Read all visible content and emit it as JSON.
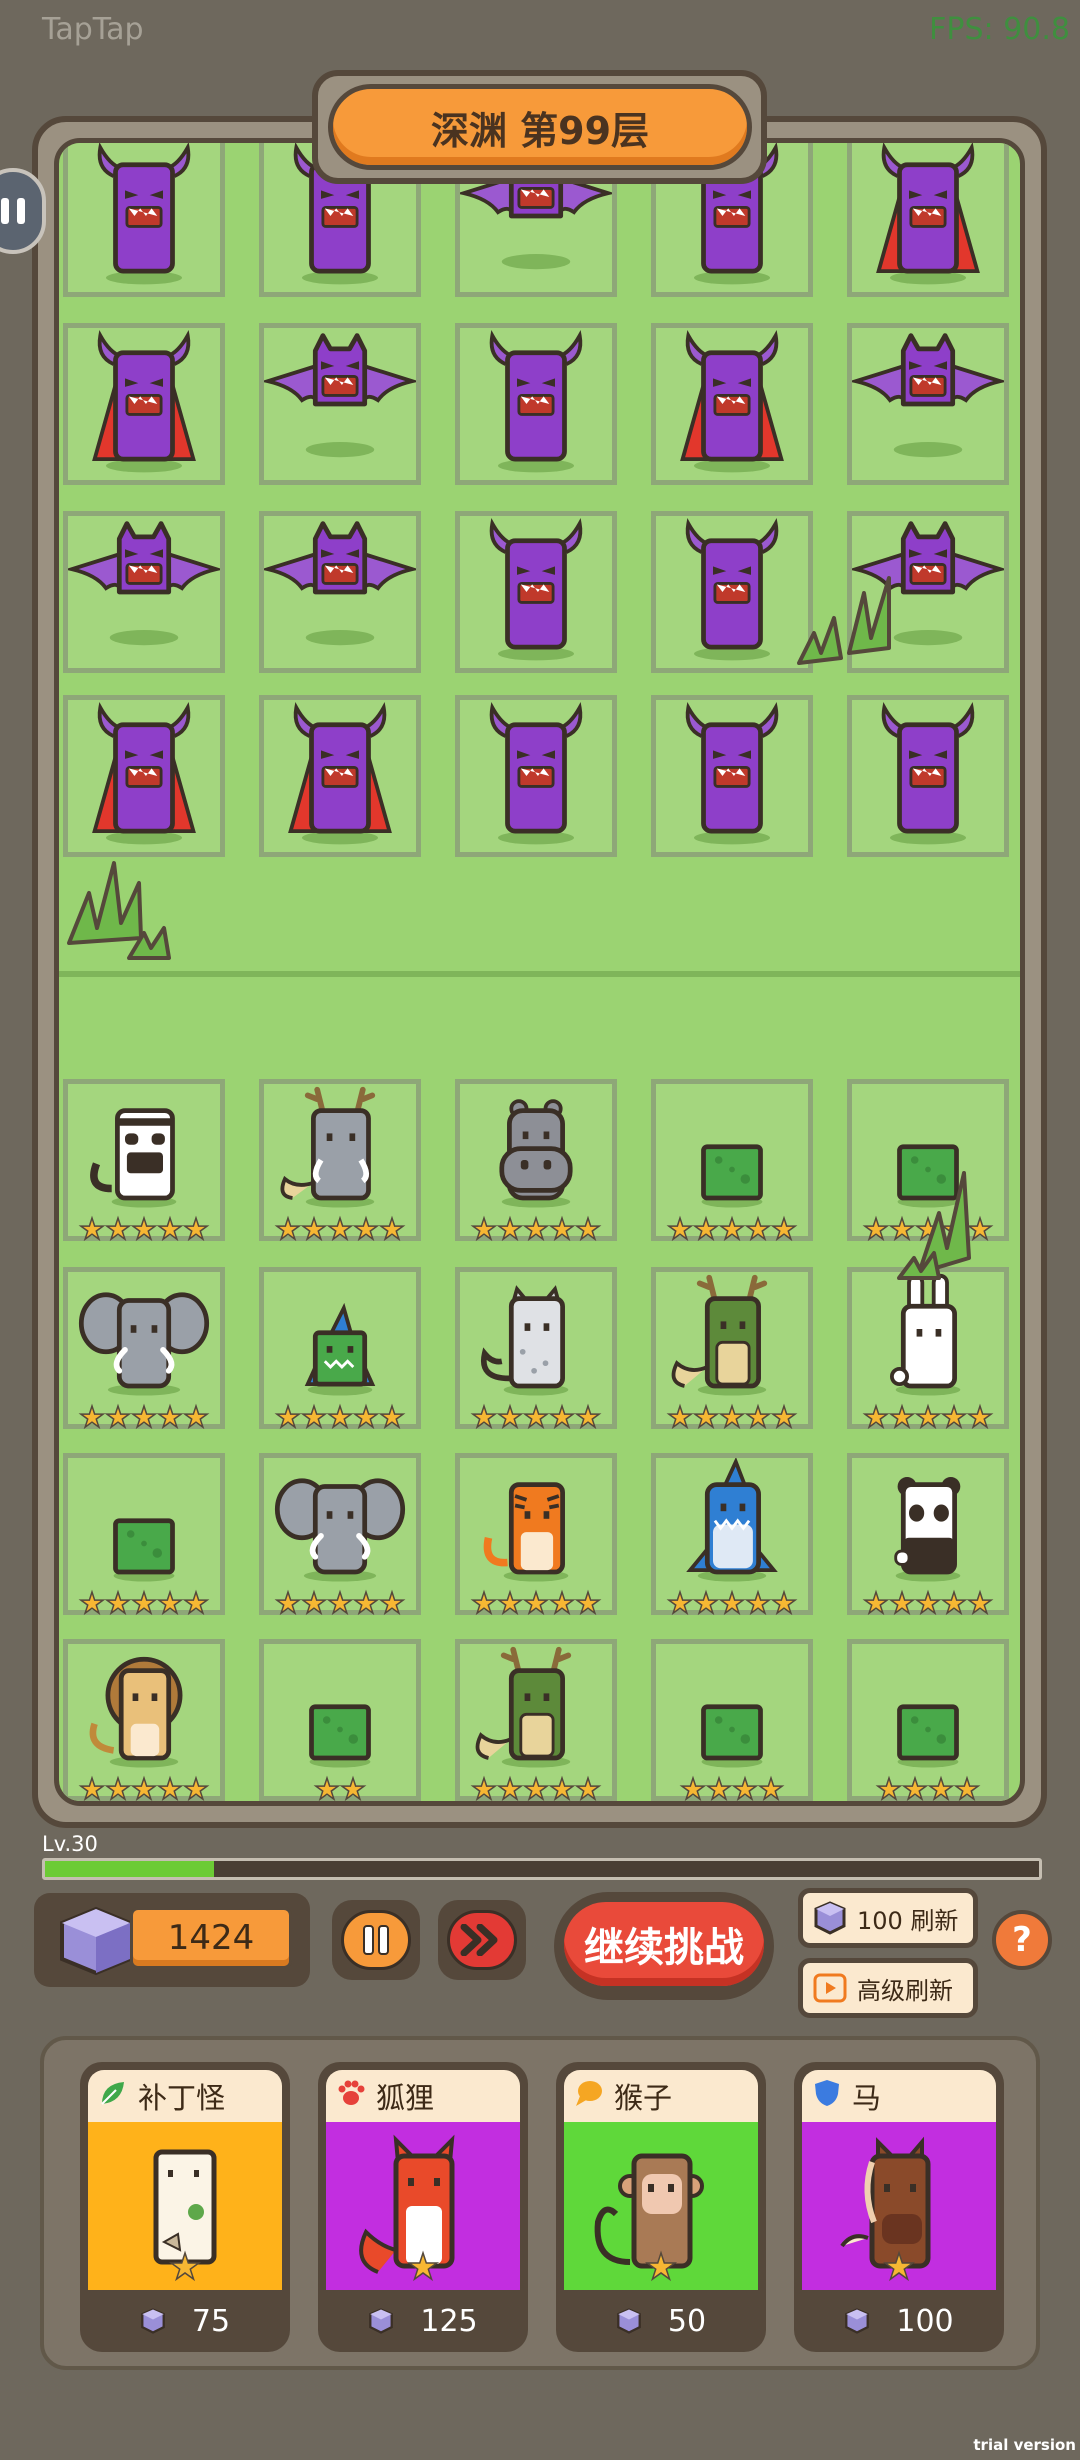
{
  "overlay": {
    "app_name": "TapTap",
    "fps": "FPS: 90.8"
  },
  "stage": {
    "title": "深渊 第99层"
  },
  "enemies": [
    [
      "devil-plain",
      "devil-plain",
      "bat",
      "devil-plain",
      "devil-cape"
    ],
    [
      "devil-cape",
      "bat",
      "devil-plain",
      "devil-cape",
      "bat"
    ],
    [
      "bat",
      "bat",
      "devil-plain",
      "devil-plain",
      "bat"
    ],
    [
      "devil-cape",
      "devil-cape",
      "devil-plain",
      "devil-plain",
      "devil-plain"
    ]
  ],
  "team": [
    [
      {
        "unit": "panda-tiger",
        "stars": 5
      },
      {
        "unit": "mammoth-dragon",
        "stars": 5
      },
      {
        "unit": "hippo",
        "stars": 5
      },
      {
        "unit": "slime",
        "stars": 5
      },
      {
        "unit": "slime",
        "stars": 5
      }
    ],
    [
      {
        "unit": "elephant",
        "stars": 5
      },
      {
        "unit": "shark-slime",
        "stars": 5
      },
      {
        "unit": "snow-leopard",
        "stars": 5
      },
      {
        "unit": "dragon",
        "stars": 5
      },
      {
        "unit": "rabbit",
        "stars": 5
      }
    ],
    [
      {
        "unit": "slime",
        "stars": 5
      },
      {
        "unit": "elephant",
        "stars": 5
      },
      {
        "unit": "tiger",
        "stars": 5
      },
      {
        "unit": "shark",
        "stars": 5
      },
      {
        "unit": "panda",
        "stars": 5
      }
    ],
    [
      {
        "unit": "lion",
        "stars": 5
      },
      {
        "unit": "slime",
        "stars": 2
      },
      {
        "unit": "dragon",
        "stars": 5
      },
      {
        "unit": "slime",
        "stars": 4
      },
      {
        "unit": "slime",
        "stars": 4
      }
    ]
  ],
  "player": {
    "level_label": "Lv.30",
    "xp_progress": 0.17,
    "gems": "1424"
  },
  "controls": {
    "continue_label": "继续挑战",
    "refresh_label": "100 刷新",
    "advanced_refresh_label": "高级刷新",
    "help_label": "?"
  },
  "shop": [
    {
      "name": "补丁怪",
      "type_icon": "leaf-icon",
      "color": "#ffb21a",
      "head_color": "#3fa84a",
      "price": "75",
      "stars": 1
    },
    {
      "name": "狐狸",
      "type_icon": "paw-icon",
      "color": "#c22ee0",
      "head_color": "#e6413a",
      "price": "125",
      "stars": 1
    },
    {
      "name": "猴子",
      "type_icon": "chat-bubble-icon",
      "color": "#5fd83a",
      "head_color": "#f5a623",
      "price": "50",
      "stars": 1
    },
    {
      "name": "马",
      "type_icon": "shield-icon",
      "color": "#c22ee0",
      "head_color": "#3b7be0",
      "price": "100",
      "stars": 1
    }
  ],
  "watermark": "trial version"
}
